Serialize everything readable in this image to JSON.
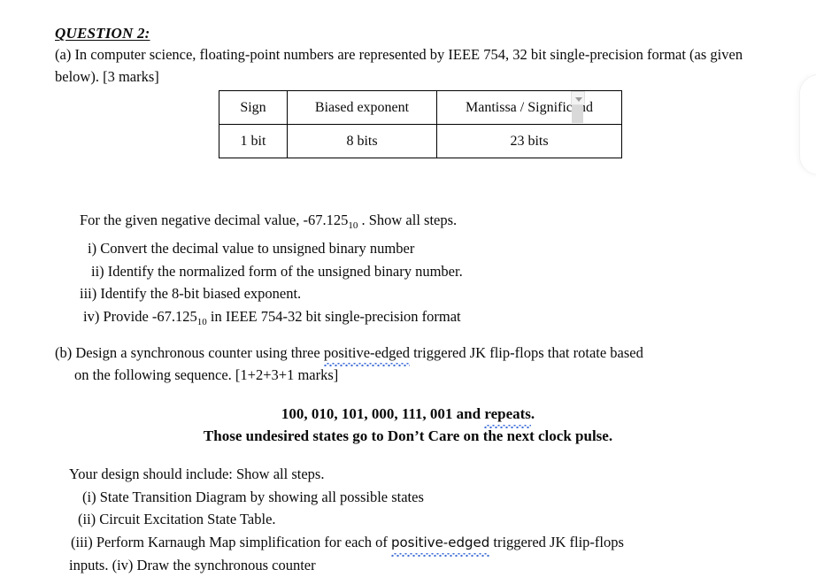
{
  "document": {
    "heading": "QUESTION 2:",
    "part_a": {
      "text_before_marks": "(a) In computer science, floating-point numbers are represented by IEEE 754, 32 bit single-precision format (as given below). [3 marks]",
      "line1": "(a) In computer science, floating-point numbers are represented by IEEE 754, 32 bit single-precision",
      "line2": "format (as given below). [3 marks]",
      "table": {
        "headers": [
          "Sign",
          "Biased exponent",
          "Mantissa / Significand"
        ],
        "values": [
          "1 bit",
          "8 bits",
          "23 bits"
        ]
      },
      "steps_intro_before": "For the given negative decimal value, -67.125",
      "steps_intro_sub": "10",
      "steps_intro_after": " . Show all steps.",
      "steps": [
        "i) Convert the decimal value to unsigned binary number",
        "ii) Identify the normalized form of the unsigned binary number.",
        "iii) Identify the 8-bit biased exponent."
      ],
      "step_iv_before": "iv) Provide -67.125",
      "step_iv_sub": "10",
      "step_iv_after": " in IEEE 754-32 bit single-precision format"
    },
    "part_b": {
      "line1_before": "(b) Design a synchronous counter using three ",
      "line1_misspelled": "positive-edged",
      "line1_after": " triggered JK flip-flops that rotate based",
      "line2": "on the following sequence. [1+2+3+1 marks]",
      "sequence_before": "100, 010, 101, 000, 111, 001 and ",
      "sequence_misspelled": "repeats",
      "sequence_after": ".",
      "undesired_states_note": "Those undesired states go to Don’t Care on the next clock pulse.",
      "design_intro": "Your design should include: Show all steps.",
      "design_item_i": "(i) State Transition Diagram by showing all possible states",
      "design_item_ii": "(ii) Circuit Excitation State Table.",
      "design_item_iii_before": "(iii) Perform Karnaugh Map simplification for each of ",
      "design_item_iii_misspelled": "positive-edged",
      "design_item_iii_after": " triggered JK flip-flops",
      "design_item_iv": "inputs.  (iv) Draw the synchronous counter"
    }
  },
  "widgets": {
    "table_scrollbar": {
      "arrow_icon": "chevron-down-icon",
      "direction": "down"
    },
    "right_panel": {
      "label": ""
    }
  },
  "colors": {
    "page_background": "#ffffff",
    "text": "#0a0a0a",
    "spellcheck_underline": "#3f6fd8",
    "table_border": "#000000",
    "scrollbar_thumb": "#d9d9d9"
  }
}
